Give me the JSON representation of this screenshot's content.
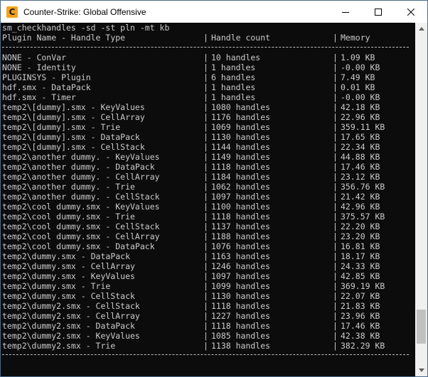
{
  "window": {
    "title": "Counter-Strike: Global Offensive",
    "app_icon_glyph": "C",
    "controls": [
      "minimize-icon",
      "maximize-icon",
      "close-icon"
    ]
  },
  "console": {
    "command": "sm_checkhandles -sd -st pln -mt kb",
    "header": {
      "col1": "Plugin Name - Handle Type",
      "col2": "Handle count",
      "col3": "Memory"
    },
    "separator": "|",
    "rows": [
      {
        "name": "NONE - ConVar",
        "count": "10 handles",
        "memory": "1.09 KB"
      },
      {
        "name": "NONE - Identity",
        "count": "1 handles",
        "memory": "-0.00 KB"
      },
      {
        "name": "PLUGINSYS - Plugin",
        "count": "6 handles",
        "memory": "7.49 KB"
      },
      {
        "name": "hdf.smx - DataPack",
        "count": "1 handles",
        "memory": "0.01 KB"
      },
      {
        "name": "hdf.smx - Timer",
        "count": "1 handles",
        "memory": "-0.00 KB"
      },
      {
        "name": "temp2\\[dummy].smx - KeyValues",
        "count": "1080 handles",
        "memory": "42.18 KB"
      },
      {
        "name": "temp2\\[dummy].smx - CellArray",
        "count": "1176 handles",
        "memory": "22.96 KB"
      },
      {
        "name": "temp2\\[dummy].smx - Trie",
        "count": "1069 handles",
        "memory": "359.11 KB"
      },
      {
        "name": "temp2\\[dummy].smx - DataPack",
        "count": "1130 handles",
        "memory": "17.65 KB"
      },
      {
        "name": "temp2\\[dummy].smx - CellStack",
        "count": "1144 handles",
        "memory": "22.34 KB"
      },
      {
        "name": "temp2\\another dummy. - KeyValues",
        "count": "1149 handles",
        "memory": "44.88 KB"
      },
      {
        "name": "temp2\\another dummy. - DataPack",
        "count": "1118 handles",
        "memory": "17.46 KB"
      },
      {
        "name": "temp2\\another dummy. - CellArray",
        "count": "1184 handles",
        "memory": "23.12 KB"
      },
      {
        "name": "temp2\\another dummy. - Trie",
        "count": "1062 handles",
        "memory": "356.76 KB"
      },
      {
        "name": "temp2\\another dummy. - CellStack",
        "count": "1097 handles",
        "memory": "21.42 KB"
      },
      {
        "name": "temp2\\cool dummy.smx - KeyValues",
        "count": "1100 handles",
        "memory": "42.96 KB"
      },
      {
        "name": "temp2\\cool dummy.smx - Trie",
        "count": "1118 handles",
        "memory": "375.57 KB"
      },
      {
        "name": "temp2\\cool dummy.smx - CellStack",
        "count": "1137 handles",
        "memory": "22.20 KB"
      },
      {
        "name": "temp2\\cool dummy.smx - CellArray",
        "count": "1188 handles",
        "memory": "23.20 KB"
      },
      {
        "name": "temp2\\cool dummy.smx - DataPack",
        "count": "1076 handles",
        "memory": "16.81 KB"
      },
      {
        "name": "temp2\\dummy.smx - DataPack",
        "count": "1163 handles",
        "memory": "18.17 KB"
      },
      {
        "name": "temp2\\dummy.smx - CellArray",
        "count": "1246 handles",
        "memory": "24.33 KB"
      },
      {
        "name": "temp2\\dummy.smx - KeyValues",
        "count": "1097 handles",
        "memory": "42.85 KB"
      },
      {
        "name": "temp2\\dummy.smx - Trie",
        "count": "1099 handles",
        "memory": "369.19 KB"
      },
      {
        "name": "temp2\\dummy.smx - CellStack",
        "count": "1130 handles",
        "memory": "22.07 KB"
      },
      {
        "name": "temp2\\dummy2.smx - CellStack",
        "count": "1118 handles",
        "memory": "21.83 KB"
      },
      {
        "name": "temp2\\dummy2.smx - CellArray",
        "count": "1227 handles",
        "memory": "23.96 KB"
      },
      {
        "name": "temp2\\dummy2.smx - DataPack",
        "count": "1118 handles",
        "memory": "17.46 KB"
      },
      {
        "name": "temp2\\dummy2.smx - KeyValues",
        "count": "1085 handles",
        "memory": "42.38 KB"
      },
      {
        "name": "temp2\\dummy2.smx - Trie",
        "count": "1138 handles",
        "memory": "382.29 KB"
      }
    ],
    "colors": {
      "background": "#0c0c0c",
      "text": "#cccccc"
    }
  },
  "scrollbar": {
    "position": 0.93
  }
}
